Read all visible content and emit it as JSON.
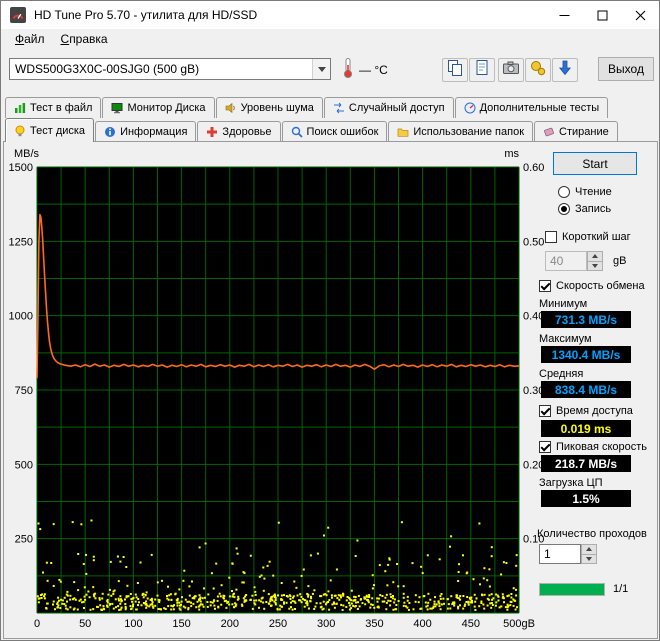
{
  "window": {
    "title": "HD Tune Pro 5.70 - утилита для HD/SSD"
  },
  "menu": {
    "items": [
      {
        "label": "Файл"
      },
      {
        "label": "Справка"
      }
    ]
  },
  "toolbar": {
    "drive_select": "WDS500G3X0C-00SJG0 (500 gB)",
    "temperature": "— °C",
    "exit_label": "Выход",
    "icons": [
      "thermometer-icon",
      "copy-icon",
      "copy-page-icon",
      "camera-icon",
      "performance-icon",
      "download-icon"
    ]
  },
  "tabs": {
    "row1": [
      {
        "label": "Тест в файл",
        "icon": "file-test-icon"
      },
      {
        "label": "Монитор Диска",
        "icon": "disk-monitor-icon"
      },
      {
        "label": "Уровень шума",
        "icon": "noise-level-icon"
      },
      {
        "label": "Случайный доступ",
        "icon": "random-access-icon"
      },
      {
        "label": "Дополнительные  тесты",
        "icon": "extra-tests-icon"
      }
    ],
    "row2": [
      {
        "label": "Тест диска",
        "icon": "disk-test-icon",
        "active": true
      },
      {
        "label": "Информация",
        "icon": "info-icon"
      },
      {
        "label": "Здоровье",
        "icon": "health-icon"
      },
      {
        "label": "Поиск ошибок",
        "icon": "error-scan-icon"
      },
      {
        "label": "Использование папок",
        "icon": "folder-usage-icon"
      },
      {
        "label": "Стирание",
        "icon": "erase-icon"
      }
    ]
  },
  "chart_data": {
    "type": "line+scatter",
    "ylabel_left": "MB/s",
    "ylabel_right": "ms",
    "x_range": [
      0,
      500
    ],
    "y_left_range": [
      0,
      1500
    ],
    "y_right_range": [
      0,
      0.6
    ],
    "y_left_ticks": [
      1500,
      1250,
      1000,
      750,
      500,
      250
    ],
    "y_right_ticks": [
      "0.60",
      "0.50",
      "0.40",
      "0.30",
      "0.20",
      "0.10"
    ],
    "x_tick_values": [
      0,
      50,
      100,
      150,
      200,
      250,
      300,
      350,
      400,
      450,
      500
    ],
    "x_tick_labels": [
      "0",
      "50",
      "100",
      "150",
      "200",
      "250",
      "300",
      "350",
      "400",
      "450",
      "500gB"
    ],
    "grid_minor_x": 25,
    "grid_minor_y": 125,
    "grid_on": true,
    "colors": {
      "background": "#000000",
      "grid": "#006400",
      "speed_line": "#ff6a1e",
      "access_dots": "#ffff00"
    },
    "scatter_seed": 42,
    "series": [
      {
        "name": "write-speed-MBs",
        "type": "line",
        "points": [
          [
            0,
            790
          ],
          [
            1,
            1005
          ],
          [
            2,
            1250
          ],
          [
            3,
            1340
          ],
          [
            4,
            1332
          ],
          [
            5,
            1298
          ],
          [
            6,
            1248
          ],
          [
            7,
            1190
          ],
          [
            8,
            1128
          ],
          [
            9,
            1072
          ],
          [
            10,
            1020
          ],
          [
            11,
            976
          ],
          [
            12,
            940
          ],
          [
            13,
            912
          ],
          [
            14,
            892
          ],
          [
            15,
            878
          ],
          [
            16,
            868
          ],
          [
            17,
            860
          ],
          [
            18,
            854
          ],
          [
            20,
            846
          ],
          [
            22,
            841
          ],
          [
            24,
            838
          ],
          [
            26,
            836
          ],
          [
            28,
            834
          ],
          [
            30,
            833
          ],
          [
            35,
            830
          ],
          [
            40,
            834
          ],
          [
            45,
            828
          ],
          [
            50,
            835
          ],
          [
            55,
            829
          ],
          [
            60,
            837
          ],
          [
            65,
            830
          ],
          [
            70,
            834
          ],
          [
            75,
            827
          ],
          [
            80,
            833
          ],
          [
            85,
            829
          ],
          [
            90,
            836
          ],
          [
            95,
            830
          ],
          [
            100,
            834
          ],
          [
            105,
            828
          ],
          [
            110,
            833
          ],
          [
            115,
            829
          ],
          [
            120,
            836
          ],
          [
            125,
            830
          ],
          [
            130,
            834
          ],
          [
            135,
            827
          ],
          [
            140,
            833
          ],
          [
            145,
            829
          ],
          [
            150,
            835
          ],
          [
            155,
            828
          ],
          [
            160,
            834
          ],
          [
            165,
            830
          ],
          [
            170,
            836
          ],
          [
            175,
            828
          ],
          [
            180,
            833
          ],
          [
            185,
            829
          ],
          [
            190,
            835
          ],
          [
            195,
            830
          ],
          [
            200,
            834
          ],
          [
            205,
            827
          ],
          [
            210,
            833
          ],
          [
            215,
            830
          ],
          [
            220,
            836
          ],
          [
            225,
            828
          ],
          [
            230,
            834
          ],
          [
            235,
            829
          ],
          [
            240,
            835
          ],
          [
            245,
            828
          ],
          [
            250,
            833
          ],
          [
            255,
            830
          ],
          [
            260,
            836
          ],
          [
            265,
            829
          ],
          [
            270,
            834
          ],
          [
            275,
            827
          ],
          [
            280,
            833
          ],
          [
            285,
            830
          ],
          [
            290,
            835
          ],
          [
            295,
            828
          ],
          [
            300,
            834
          ],
          [
            305,
            829
          ],
          [
            310,
            836
          ],
          [
            315,
            830
          ],
          [
            320,
            833
          ],
          [
            325,
            827
          ],
          [
            330,
            834
          ],
          [
            335,
            829
          ],
          [
            340,
            836
          ],
          [
            345,
            830
          ],
          [
            350,
            820
          ],
          [
            355,
            831
          ],
          [
            360,
            835
          ],
          [
            365,
            828
          ],
          [
            370,
            834
          ],
          [
            375,
            829
          ],
          [
            380,
            836
          ],
          [
            385,
            830
          ],
          [
            390,
            833
          ],
          [
            395,
            827
          ],
          [
            400,
            834
          ],
          [
            405,
            829
          ],
          [
            410,
            835
          ],
          [
            415,
            828
          ],
          [
            420,
            834
          ],
          [
            425,
            830
          ],
          [
            430,
            836
          ],
          [
            435,
            828
          ],
          [
            440,
            833
          ],
          [
            445,
            829
          ],
          [
            450,
            835
          ],
          [
            455,
            830
          ],
          [
            460,
            834
          ],
          [
            465,
            828
          ],
          [
            470,
            833
          ],
          [
            475,
            829
          ],
          [
            480,
            835
          ],
          [
            485,
            828
          ],
          [
            490,
            833
          ],
          [
            495,
            830
          ],
          [
            500,
            831
          ]
        ]
      },
      {
        "name": "access-time-ms",
        "type": "scatter-band",
        "bands": [
          {
            "count": 620,
            "ms": [
              0.004,
              0.026
            ]
          },
          {
            "count": 120,
            "ms": [
              0.026,
              0.08
            ]
          },
          {
            "count": 18,
            "ms": [
              0.08,
              0.125
            ]
          }
        ]
      }
    ]
  },
  "panel": {
    "start_label": "Start",
    "read_label": "Чтение",
    "read_checked": false,
    "write_label": "Запись",
    "write_checked": true,
    "short_step_label": "Короткий шаг",
    "short_step_checked": false,
    "short_step_value": "40",
    "short_step_unit": "gB",
    "transfer_label": "Скорость обмена",
    "transfer_checked": true,
    "min_label": "Минимум",
    "min_value": "731.3 MB/s",
    "max_label": "Максимум",
    "max_value": "1340.4 MB/s",
    "avg_label": "Средняя",
    "avg_value": "838.4 MB/s",
    "access_label": "Время доступа",
    "access_checked": true,
    "access_value": "0.019 ms",
    "burst_label": "Пиковая скорость",
    "burst_checked": true,
    "burst_value": "218.7 MB/s",
    "cpu_label": "Загрузка ЦП",
    "cpu_value": "1.5%",
    "passes_label": "Количество проходов",
    "passes_value": "1",
    "progress_percent": 100,
    "progress_text": "1/1",
    "progress_color": "#00b050",
    "value_colors": {
      "speed": "#00a2ff",
      "access": "#ffff00",
      "burst": "#ffffff",
      "cpu": "#ffffff"
    }
  }
}
